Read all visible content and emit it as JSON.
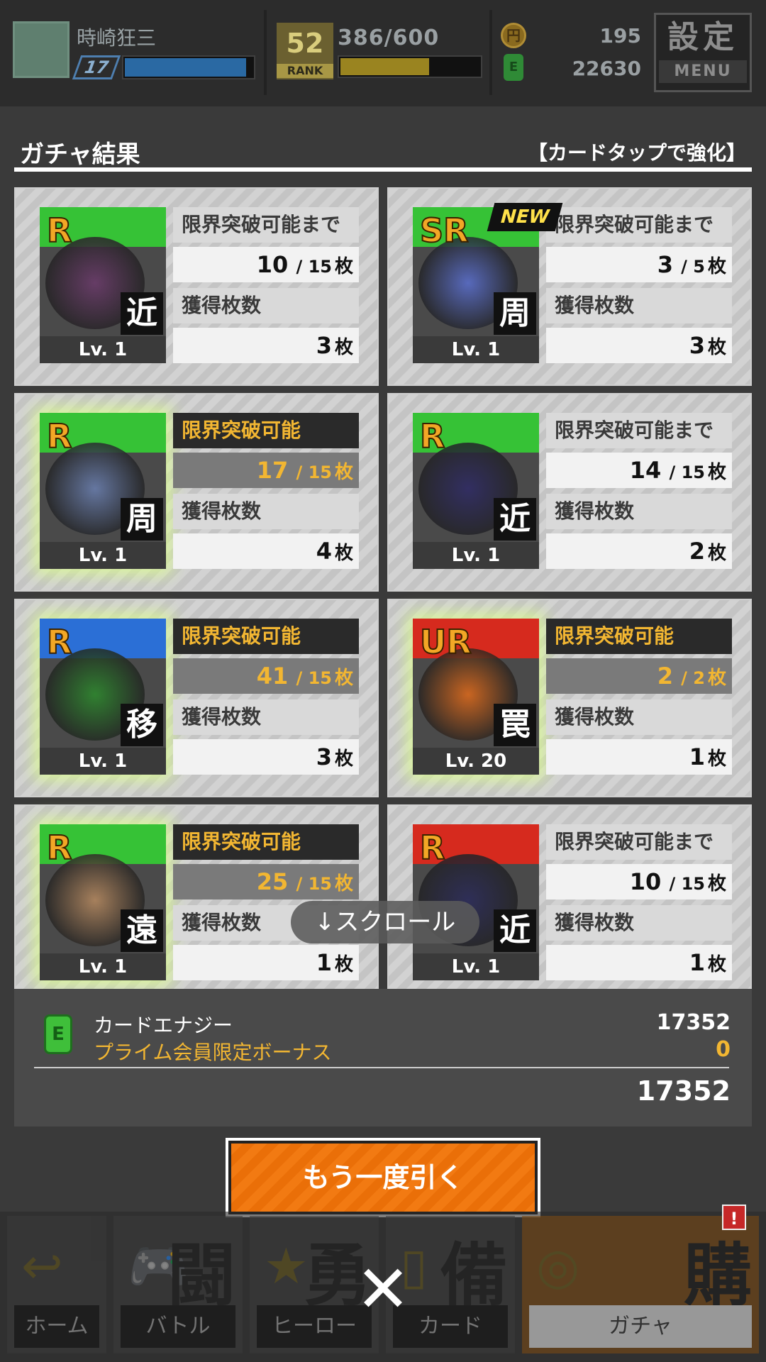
{
  "header": {
    "player_name": "時崎狂三",
    "level": "17",
    "hp_fill": 0.95,
    "rank": "52",
    "rank_label": "RANK",
    "exp": "386/600",
    "exp_fill": 0.64,
    "coin_icon": "円",
    "coins": "195",
    "energy_icon": "E",
    "energy": "22630",
    "menu_kanji": "設定",
    "menu_label": "MENU"
  },
  "panel": {
    "title": "ガチャ結果",
    "hint": "【カードタップで強化】"
  },
  "cards": [
    {
      "rarity": "R",
      "type": "近",
      "level": "Lv. 1",
      "label1": "限界突破可能まで",
      "cur": "10",
      "max": "15",
      "unit": "枚",
      "label2": "獲得枚数",
      "count": "3",
      "glow": false,
      "new": false
    },
    {
      "rarity": "SR",
      "type": "周",
      "level": "Lv. 1",
      "label1": "限界突破可能まで",
      "cur": "3",
      "max": "5",
      "unit": "枚",
      "label2": "獲得枚数",
      "count": "3",
      "glow": false,
      "new": true,
      "new_label": "NEW"
    },
    {
      "rarity": "R",
      "type": "周",
      "level": "Lv. 1",
      "label1": "限界突破可能",
      "cur": "17",
      "max": "15",
      "unit": "枚",
      "label2": "獲得枚数",
      "count": "4",
      "glow": true,
      "new": false
    },
    {
      "rarity": "R",
      "type": "近",
      "level": "Lv. 1",
      "label1": "限界突破可能まで",
      "cur": "14",
      "max": "15",
      "unit": "枚",
      "label2": "獲得枚数",
      "count": "2",
      "glow": false,
      "new": false
    },
    {
      "rarity": "R",
      "type": "移",
      "level": "Lv. 1",
      "label1": "限界突破可能",
      "cur": "41",
      "max": "15",
      "unit": "枚",
      "label2": "獲得枚数",
      "count": "3",
      "glow": true,
      "new": false
    },
    {
      "rarity": "UR",
      "type": "罠",
      "level": "Lv. 20",
      "label1": "限界突破可能",
      "cur": "2",
      "max": "2",
      "unit": "枚",
      "label2": "獲得枚数",
      "count": "1",
      "glow": true,
      "new": false
    },
    {
      "rarity": "R",
      "type": "遠",
      "level": "Lv. 1",
      "label1": "限界突破可能",
      "cur": "25",
      "max": "15",
      "unit": "枚",
      "label2": "獲得枚数",
      "count": "1",
      "glow": true,
      "new": false
    },
    {
      "rarity": "R",
      "type": "近",
      "level": "Lv. 1",
      "label1": "限界突破可能まで",
      "cur": "10",
      "max": "15",
      "unit": "枚",
      "label2": "獲得枚数",
      "count": "1",
      "glow": false,
      "new": false
    }
  ],
  "scroll_hint": "↓スクロール",
  "summary": {
    "icon": "E",
    "energy_label": "カードエナジー",
    "energy_value": "17352",
    "bonus_label": "プライム会員限定ボーナス",
    "bonus_value": "0",
    "total": "17352"
  },
  "again_button": "もう一度引く",
  "nav": [
    {
      "label": "ホーム",
      "kanji": "",
      "icon": "↩",
      "icon_name": "home-return-icon"
    },
    {
      "label": "バトル",
      "kanji": "闘",
      "icon": "🎮",
      "icon_name": "gamepad-icon"
    },
    {
      "label": "ヒーロー",
      "kanji": "勇",
      "icon": "★",
      "icon_name": "hero-icon"
    },
    {
      "label": "カード",
      "kanji": "備",
      "icon": "▯",
      "icon_name": "card-icon"
    },
    {
      "label": "ガチャ",
      "kanji": "購",
      "icon": "◎",
      "icon_name": "gacha-icon"
    }
  ],
  "nav_badge": "!",
  "close": "✕",
  "colors": {
    "accent_orange": "#f27a12",
    "highlight_gold": "#f2b632",
    "rarity_gold": "#f2a726"
  }
}
